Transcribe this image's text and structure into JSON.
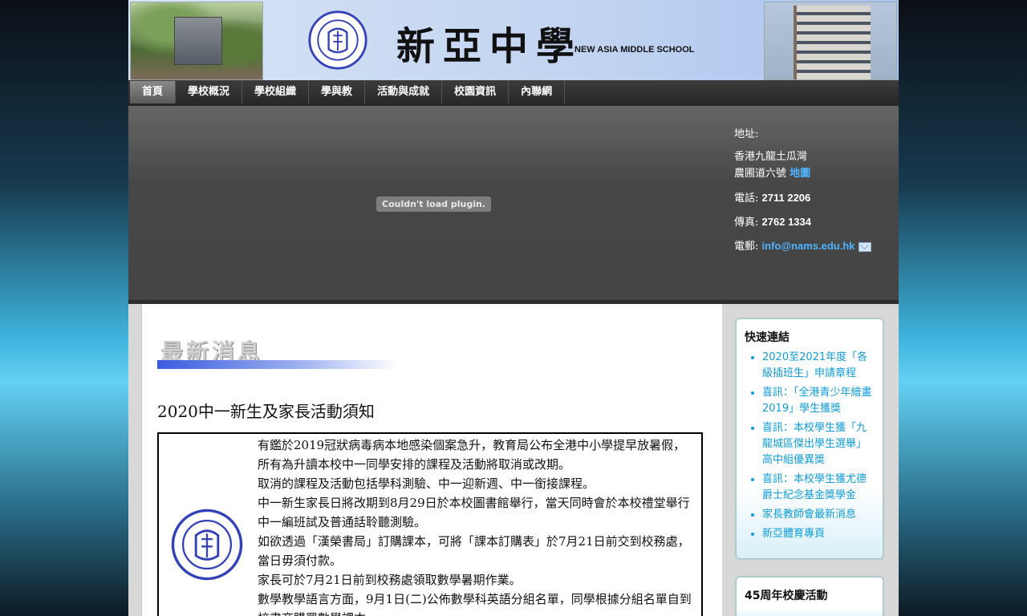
{
  "header": {
    "school_name_cn": "新亞中學",
    "school_name_en": "NEW ASIA MIDDLE SCHOOL"
  },
  "nav": {
    "items": [
      {
        "label": "首頁"
      },
      {
        "label": "學校概況"
      },
      {
        "label": "學校組織"
      },
      {
        "label": "學與教"
      },
      {
        "label": "活動與成就"
      },
      {
        "label": "校園資訊"
      },
      {
        "label": "內聯網"
      }
    ]
  },
  "banner": {
    "plugin_message": "Couldn't load plugin.",
    "address_label": "地址:",
    "address_line1": "香港九龍土瓜灣",
    "address_line2": "農圃道六號",
    "map_link": "地圖",
    "phone_label": "電話:",
    "phone": "2711 2206",
    "fax_label": "傳真:",
    "fax": "2762 1334",
    "email_label": "電郵:",
    "email": "info@nams.edu.hk"
  },
  "main": {
    "section_title": "最新消息",
    "post_title": "2020中一新生及家長活動須知",
    "paragraphs": [
      "有鑑於2019冠狀病毒病本地感染個案急升，教育局公布全港中小學提早放暑假，所有為升讀本校中一同學安排的課程及活動將取消或改期。",
      "取消的課程及活動包括學科測驗、中一迎新週、中一銜接課程。",
      "中一新生家長日將改期到8月29日於本校圖書館舉行，當天同時會於本校禮堂舉行中一編班試及普通話聆聽測驗。",
      "如欲透過「漢榮書局」訂購課本，可將「課本訂購表」於7月21日前交到校務處，當日毋須付款。",
      "家長可於7月21日前到校務處領取數學暑期作業。",
      "數學教學語言方面，9月1日(二)公佈數學科英語分組名單，同學根據分組名單自到校書商購買數學課本。"
    ]
  },
  "sidebar": {
    "quick_links_title": "快速連結",
    "quick_links": [
      "2020至2021年度「各級插班生」申請章程",
      "喜訊：「全港青少年繪畫2019」學生獲獎",
      "喜訊：本校學生獲「九龍城區傑出學生選舉」高中組優異獎",
      "喜訊：本校學生獲尤德爵士紀念基金獎學金",
      "家長教師會最新消息",
      "新亞體育專頁"
    ],
    "anniversary_title": "45周年校慶活動"
  }
}
